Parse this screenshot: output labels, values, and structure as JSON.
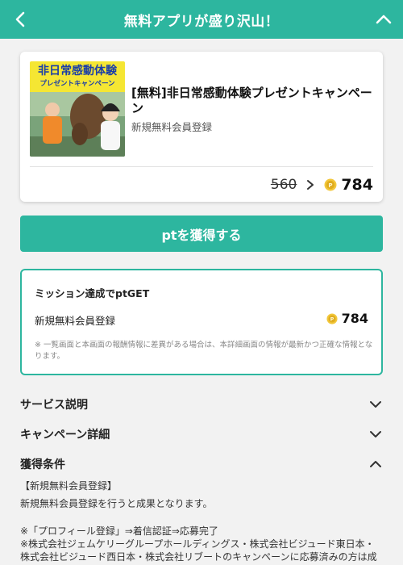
{
  "header": {
    "title": "無料アプリが盛り沢山！",
    "back_icon": "chevron-left-icon",
    "collapse_icon": "chevron-up-icon",
    "bg_color": "#2db69f"
  },
  "offer": {
    "banner_line1": "非日常感動体験",
    "banner_line2": "プレゼントキャンペーン",
    "title": "[無料]非日常感動体験プレゼントキャンペーン",
    "subtitle": "新規無料会員登録",
    "old_points": "560",
    "new_points": "784",
    "coin_icon": "point-coin-icon"
  },
  "cta": {
    "label": "ptを獲得する"
  },
  "mission": {
    "title": "ミッション達成でptGET",
    "item_label": "新規無料会員登録",
    "item_points": "784",
    "note": "※ 一覧画面と本画面の報酬情報に差異がある場合は、本詳細画面の情報が最新かつ正確な情報となります。"
  },
  "sections": {
    "service": "サービス説明",
    "campaign": "キャンペーン詳細",
    "conditions": "獲得条件"
  },
  "conditions": {
    "heading": "【新規無料会員登録】",
    "line1": "新規無料会員登録を行うと成果となります。",
    "line2": "※「プロフィール登録」⇒着信認証⇒応募完了",
    "line3": "※株式会社ジェムケリーグループホールディングス・株式会社ビジュード東日本・",
    "line4": "株式会社ビジュード西日本・株式会社リブートのキャンペーンに応募済みの方は成"
  }
}
